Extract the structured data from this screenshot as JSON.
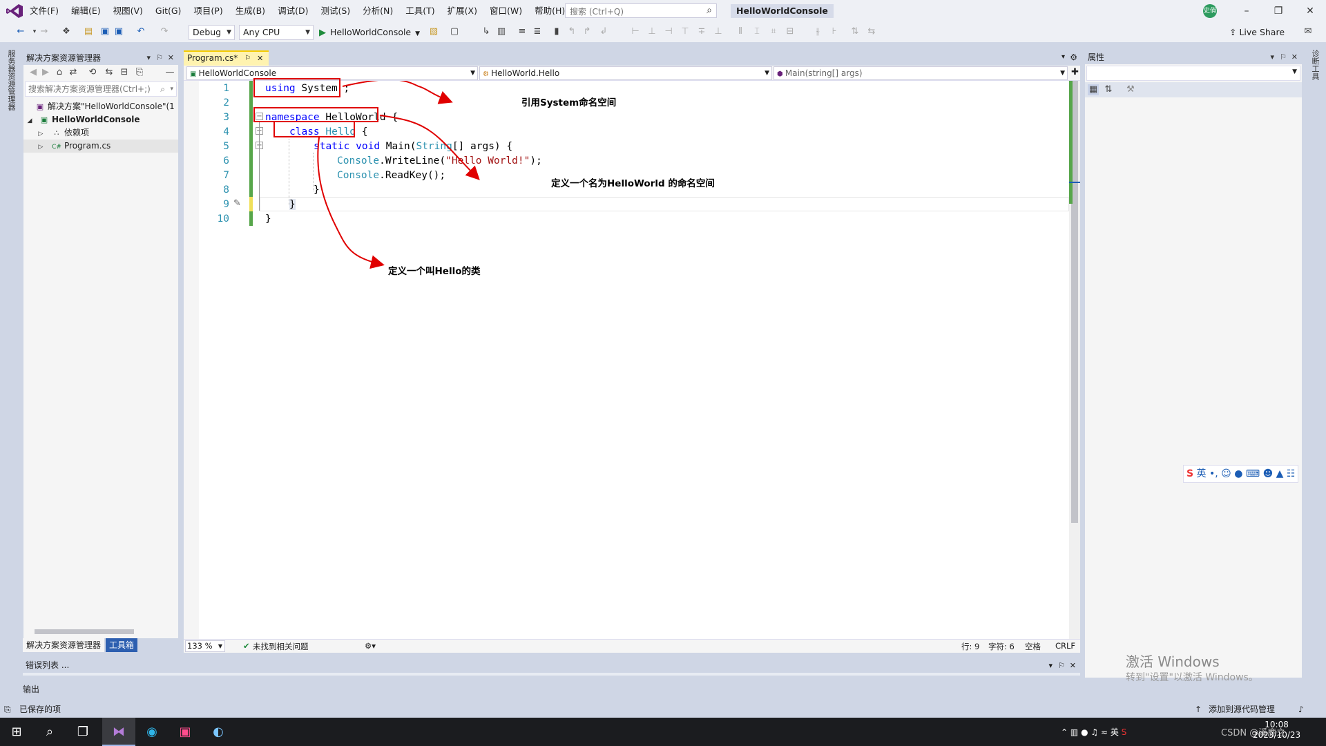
{
  "menu": {
    "items": [
      "文件(F)",
      "编辑(E)",
      "视图(V)",
      "Git(G)",
      "项目(P)",
      "生成(B)",
      "调试(D)",
      "测试(S)",
      "分析(N)",
      "工具(T)",
      "扩展(X)",
      "窗口(W)",
      "帮助(H)"
    ],
    "search_placeholder": "搜索 (Ctrl+Q)",
    "solution_name": "HelloWorldConsole",
    "user_initials": "史俏"
  },
  "toolbar": {
    "config": "Debug",
    "platform": "Any CPU",
    "run_target": "HelloWorldConsole",
    "live_share": "Live Share"
  },
  "left_strip": {
    "label": "服务器资源管理器"
  },
  "right_strip": {
    "label": "诊断工具"
  },
  "solution_explorer": {
    "title": "解决方案资源管理器",
    "search_placeholder": "搜索解决方案资源管理器(Ctrl+;)",
    "tree": [
      {
        "label": "解决方案\"HelloWorldConsole\"(1",
        "level": 0
      },
      {
        "label": "HelloWorldConsole",
        "level": 1
      },
      {
        "label": "依赖项",
        "level": 2
      },
      {
        "label": "Program.cs",
        "level": 2
      }
    ],
    "bottom_tabs": [
      "解决方案资源管理器",
      "工具箱"
    ]
  },
  "editor": {
    "tab_label": "Program.cs*",
    "nav_project": "HelloWorldConsole",
    "nav_class": "HelloWorld.Hello",
    "nav_member": "Main(string[] args)",
    "line_numbers": [
      "1",
      "2",
      "3",
      "4",
      "5",
      "6",
      "7",
      "8",
      "9",
      "10"
    ],
    "zoom": "133 %",
    "issues": "未找到相关问题",
    "pos_line": "行: 9",
    "pos_char": "字符: 6",
    "whitespace": "空格",
    "line_ending": "CRLF"
  },
  "code_tokens": {
    "using": "using",
    "system": "System ;",
    "namespace": "namespace",
    "helloworld": "HelloWorld {",
    "class": "class",
    "hello": "Hello",
    "brace1": " {",
    "static": "static",
    "void": "void",
    "main": "Main(",
    "string_t": "String",
    "args": "[] args) {",
    "console1": "Console",
    "writeline": ".WriteLine(",
    "strlit": "\"Hello World!\"",
    "end1": ");",
    "console2": "Console",
    "readkey": ".ReadKey();",
    "close_method": "}",
    "close_class": "}",
    "close_ns": "}"
  },
  "annotations": {
    "using": "引用System命名空间",
    "namespace": "定义一个名为HelloWorld 的命名空间",
    "class": "定义一个叫Hello的类"
  },
  "properties": {
    "title": "属性"
  },
  "error_list": {
    "title": "错误列表 ..."
  },
  "output": {
    "title": "输出"
  },
  "statusbar": {
    "left": "已保存的项",
    "right": "添加到源代码管理"
  },
  "watermark": {
    "line1": "激活 Windows",
    "line2": "转到\"设置\"以激活 Windows。"
  },
  "ime": {
    "label": "英"
  },
  "taskbar": {
    "time": "10:08",
    "date": "2023/10/23",
    "lang": "英",
    "csdn": "CSDN @溪鹿之"
  },
  "colors": {
    "keyword": "#0000ff",
    "type": "#2b91af",
    "string": "#a31515",
    "annotation_box": "#e00000",
    "vs_accent": "#68217a"
  }
}
